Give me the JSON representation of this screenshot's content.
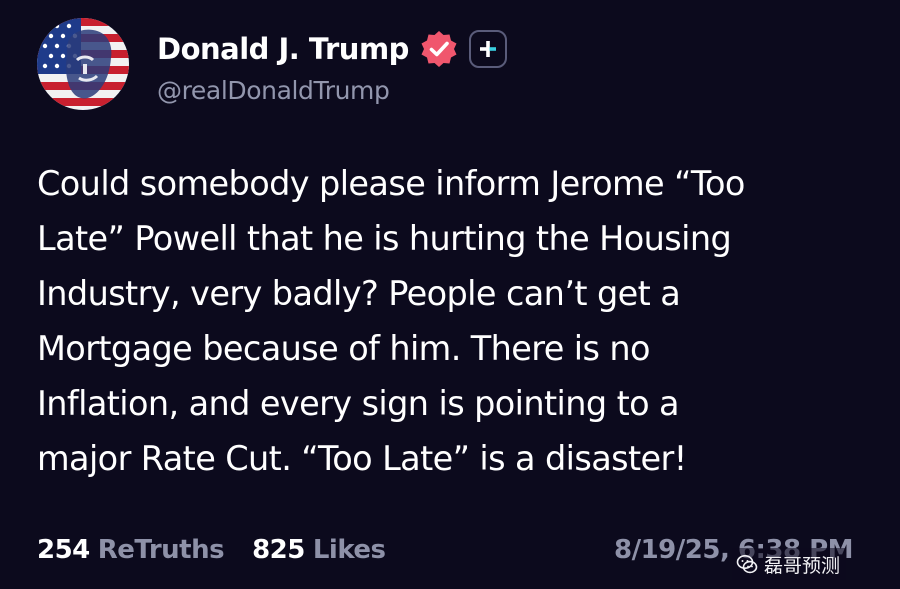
{
  "author": {
    "display_name": "Donald J. Trump",
    "handle": "@realDonaldTrump",
    "verified": true,
    "verified_badge_color": "#f0566d"
  },
  "post": {
    "lines": [
      "Could somebody please inform Jerome “Too",
      "Late” Powell that he is hurting the Housing",
      "Industry, very badly? People can’t get a",
      "Mortgage because of him. There is no",
      "Inflation, and every sign is pointing to a",
      "major Rate Cut. “Too Late” is a disaster!"
    ]
  },
  "stats": {
    "retruths_count": "254",
    "retruths_label": "ReTruths",
    "likes_count": "825",
    "likes_label": "Likes",
    "timestamp": "8/19/25, 6:38 PM"
  },
  "watermark": {
    "text": "磊哥预测"
  },
  "colors": {
    "background": "#0c0a1d",
    "text": "#ffffff",
    "muted": "#8e91a8",
    "handle": "#9296ad"
  }
}
